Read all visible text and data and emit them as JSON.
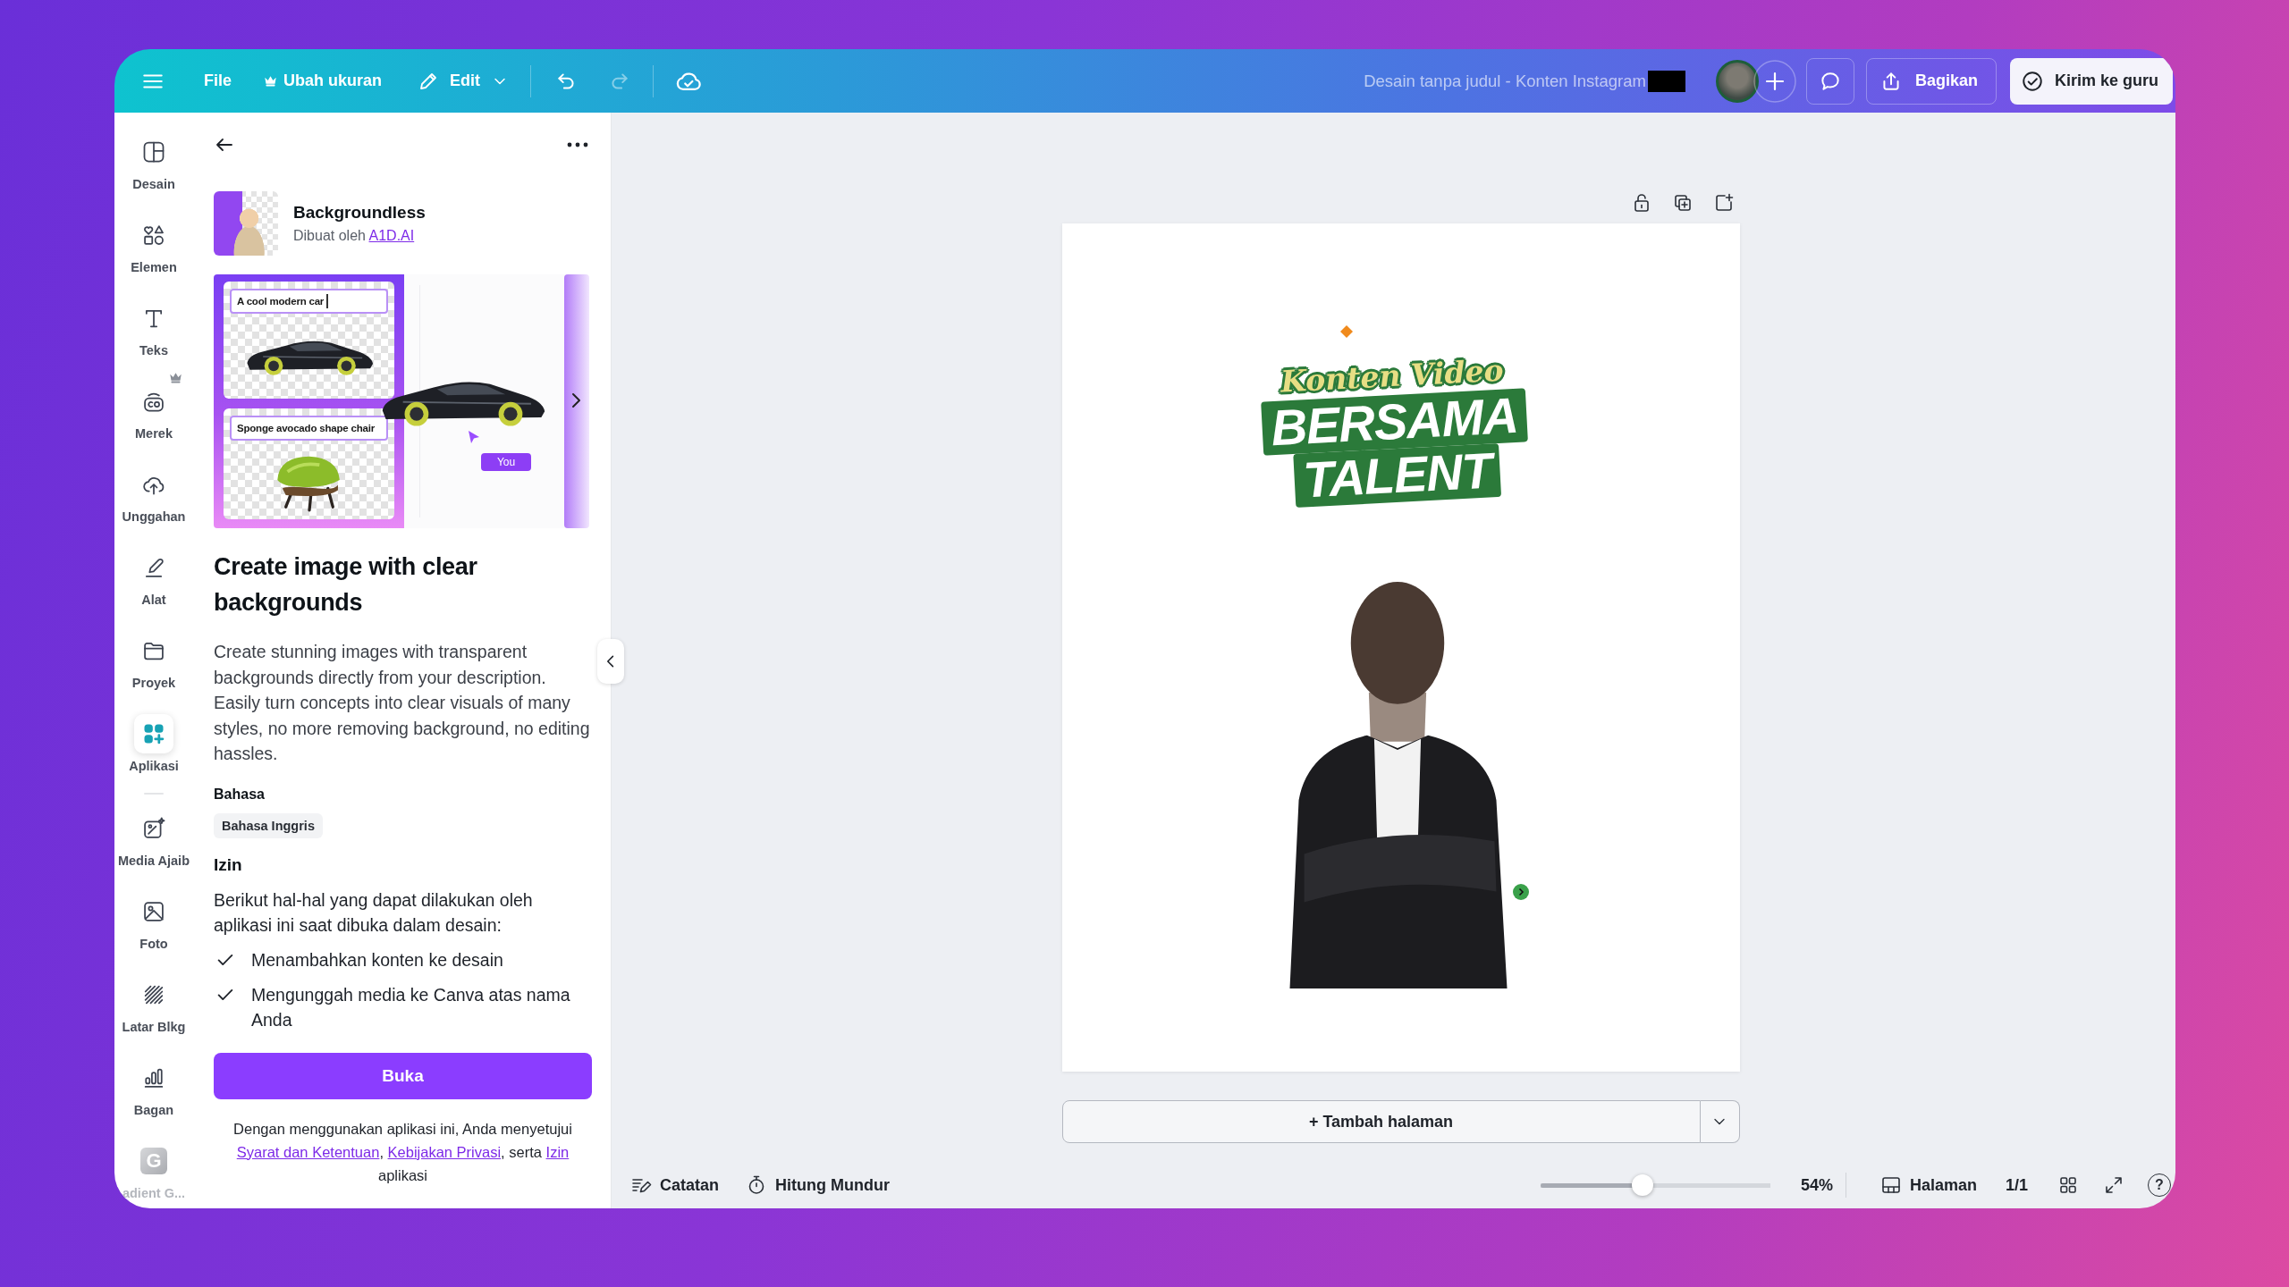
{
  "topbar": {
    "file": "File",
    "resize": {
      "label": "Ubah ukuran",
      "pro": true
    },
    "edit": "Edit",
    "undo": {
      "disabled": false
    },
    "redo": {
      "disabled": true
    },
    "title": "Desain tanpa judul - Konten Instagram",
    "share": "Bagikan",
    "submit": "Kirim ke guru"
  },
  "rail_main": [
    {
      "label": "Desain",
      "selected": false,
      "pro": false
    },
    {
      "label": "Elemen",
      "selected": false,
      "pro": false
    },
    {
      "label": "Teks",
      "selected": false,
      "pro": false
    },
    {
      "label": "Merek",
      "selected": false,
      "pro": true
    },
    {
      "label": "Unggahan",
      "selected": false,
      "pro": false
    },
    {
      "label": "Alat",
      "selected": false,
      "pro": false
    },
    {
      "label": "Proyek",
      "selected": false,
      "pro": false
    },
    {
      "label": "Aplikasi",
      "selected": true,
      "pro": false
    }
  ],
  "rail_more": [
    {
      "label": "Media Ajaib",
      "selected": false
    },
    {
      "label": "Foto",
      "selected": false
    },
    {
      "label": "Latar Blkg",
      "selected": false
    },
    {
      "label": "Bagan",
      "selected": false
    }
  ],
  "rail_app": {
    "logo": "G",
    "label": "adient G..."
  },
  "panel": {
    "app_name": "Backgroundless",
    "creator": {
      "prefix": "Dibuat oleh",
      "link": "A1D.AI"
    },
    "preview": {
      "prompts": [
        "A cool modern car",
        "Sponge avocado shape chair"
      ],
      "cursor_label": "You"
    },
    "heading": "Create image with clear backgrounds",
    "description": "Create stunning images with transparent backgrounds directly from your description. Easily turn concepts into clear visuals of many styles, no more removing background, no editing hassles.",
    "language_label": "Bahasa",
    "language": "Bahasa Inggris",
    "permissions_label": "Izin",
    "permissions_intro": "Berikut hal-hal yang dapat dilakukan oleh aplikasi ini saat dibuka dalam desain:",
    "permissions": [
      "Menambahkan konten ke desain",
      "Mengunggah media ke Canva atas nama Anda"
    ],
    "open_button": "Buka",
    "consent": [
      {
        "kind": "text",
        "text": "Dengan menggunakan aplikasi ini, Anda menyetujui "
      },
      {
        "kind": "link",
        "text": "Syarat dan Ketentuan"
      },
      {
        "kind": "text",
        "text": ", "
      },
      {
        "kind": "link",
        "text": "Kebijakan Privasi"
      },
      {
        "kind": "text",
        "text": ", serta "
      },
      {
        "kind": "link",
        "text": "Izin"
      },
      {
        "kind": "text",
        "text": " aplikasi"
      }
    ]
  },
  "design": {
    "script": "Konten Video",
    "lines": [
      "BERSAMA",
      "TALENT"
    ]
  },
  "add_page": "+ Tambah halaman",
  "footer": {
    "notes": "Catatan",
    "timer": "Hitung Mundur",
    "zoom": {
      "level": 0.44,
      "reading": "54%"
    },
    "pages": "Halaman",
    "page_count": "1/1",
    "help": "?"
  }
}
